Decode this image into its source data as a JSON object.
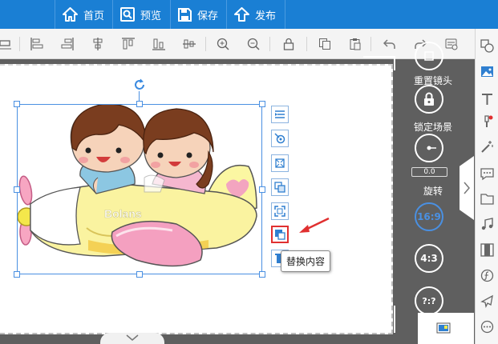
{
  "topbar": {
    "items": [
      {
        "label": "首页",
        "icon": "home-icon"
      },
      {
        "label": "预览",
        "icon": "preview-icon"
      },
      {
        "label": "保存",
        "icon": "save-icon"
      },
      {
        "label": "发布",
        "icon": "publish-icon"
      }
    ],
    "color": "#1a7fd4"
  },
  "toolbar": {
    "icons": [
      "align-left-icon",
      "align-hcenter-icon",
      "align-right-icon",
      "align-top-icon",
      "align-vcenter-icon",
      "align-bottom-icon",
      "zoom-in-icon",
      "zoom-out-icon",
      "lock-icon",
      "copy-icon",
      "paste-icon",
      "undo-icon",
      "redo-icon",
      "settings-icon"
    ]
  },
  "canvas": {
    "image_text": "Bolans",
    "tooltip": "替换内容",
    "side_tools": [
      "layer-icon",
      "animation-icon",
      "crop-icon",
      "style-icon",
      "fullscreen-icon",
      "replace-content-icon",
      "delete-icon"
    ]
  },
  "camera_panel": {
    "reset_label": "重置镜头",
    "lock_label": "锁定场景",
    "rotate_label": "旋转",
    "rotate_value": "0.0",
    "ratio_16_9": "16:9",
    "ratio_4_3": "4:3",
    "ratio_free": "?:?"
  },
  "iconbar": {
    "icons": [
      "shapes-icon",
      "image-icon",
      "text-icon",
      "brush-icon",
      "magic-wand-icon",
      "comment-icon",
      "folder-icon",
      "music-icon",
      "film-icon",
      "formula-icon",
      "airplane-icon",
      "more-icon"
    ]
  },
  "colors": {
    "accent": "#1a7fd4",
    "alert": "#e03030"
  }
}
